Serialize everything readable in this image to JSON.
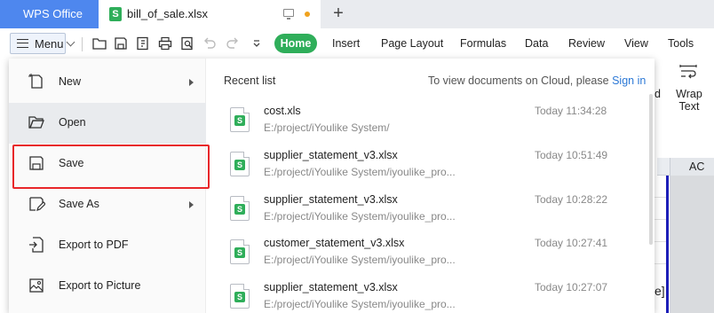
{
  "tabbar": {
    "app_tab": "WPS Office",
    "file_tab": "bill_of_sale.xlsx",
    "file_icon": "S",
    "add_tab": "+"
  },
  "toolbar": {
    "menu_label": "Menu",
    "ribbon_tabs": [
      "Home",
      "Insert",
      "Page Layout",
      "Formulas",
      "Data",
      "Review",
      "View",
      "Tools"
    ]
  },
  "sheet": {
    "wrap_text": "Wrap Text",
    "d_fragment": "d",
    "column_ac": "AC",
    "e_fragment": "e]"
  },
  "menu": {
    "items": [
      {
        "label": "New",
        "icon": "new-file-icon"
      },
      {
        "label": "Open",
        "icon": "folder-open-icon"
      },
      {
        "label": "Save",
        "icon": "save-icon"
      },
      {
        "label": "Save As",
        "icon": "save-as-icon"
      },
      {
        "label": "Export to PDF",
        "icon": "export-pdf-icon"
      },
      {
        "label": "Export to Picture",
        "icon": "export-picture-icon"
      }
    ],
    "highlight_color": "#e8272a"
  },
  "recent": {
    "title": "Recent list",
    "cloud_prompt": "To view documents on Cloud, please",
    "sign_in": "Sign in",
    "files": [
      {
        "name": "cost.xls",
        "path": "E:/project/iYoulike System/",
        "time": "Today 11:34:28"
      },
      {
        "name": "supplier_statement_v3.xlsx",
        "path": "E:/project/iYoulike System/iyoulike_pro...",
        "time": "Today 10:51:49"
      },
      {
        "name": "supplier_statement_v3.xlsx",
        "path": "E:/project/iYoulike System/iyoulike_pro...",
        "time": "Today 10:28:22"
      },
      {
        "name": "customer_statement_v3.xlsx",
        "path": "E:/project/iYoulike System/iyoulike_pro...",
        "time": "Today 10:27:41"
      },
      {
        "name": "supplier_statement_v3.xlsx",
        "path": "E:/project/iYoulike System/iyoulike_pro...",
        "time": "Today 10:27:07"
      }
    ]
  },
  "colors": {
    "app_tab": "#4e87ee",
    "accent_green": "#2fae5a",
    "link": "#2b78d6"
  }
}
